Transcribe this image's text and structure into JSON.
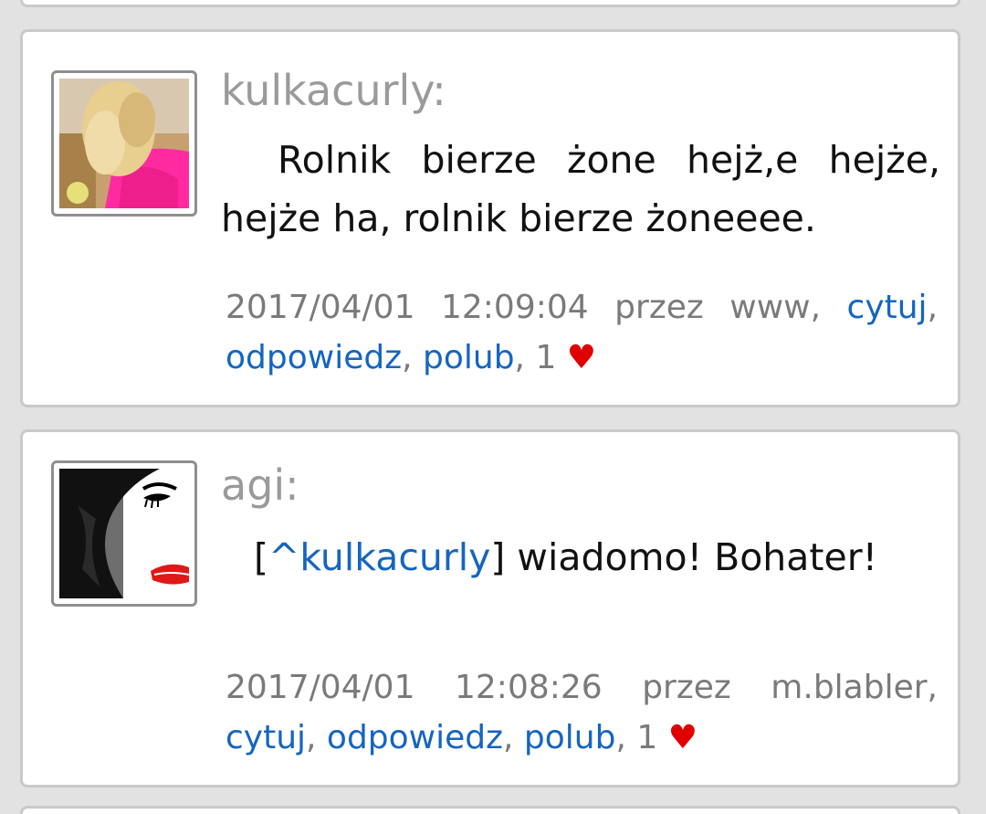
{
  "comments": [
    {
      "author": "kulkacurly:",
      "body": "Rolnik bierze żone hejż,e hejże, hejże ha, rolnik bierze żoneeee.",
      "meta": {
        "datetime": "2017/04/01 12:09:04",
        "via": "przez www,",
        "quote_label": "cytuj",
        "reply_label": "odpowiedz",
        "like_label": "polub",
        "likes_count": "1",
        "heart": "♥"
      }
    },
    {
      "author": "agi:",
      "body_prefix": "[",
      "mention": "^kulkacurly",
      "body_suffix": "] wiadomo! Bohater!",
      "meta": {
        "datetime": "2017/04/01 12:08:26",
        "via": "przez m.blabler,",
        "quote_label": "cytuj",
        "reply_label": "odpowiedz",
        "like_label": "polub",
        "likes_count": "1",
        "heart": "♥"
      }
    }
  ],
  "colors": {
    "link": "#1565c0",
    "heart": "#e00000",
    "author": "#9a9a9a",
    "meta": "#7a7a7a"
  }
}
